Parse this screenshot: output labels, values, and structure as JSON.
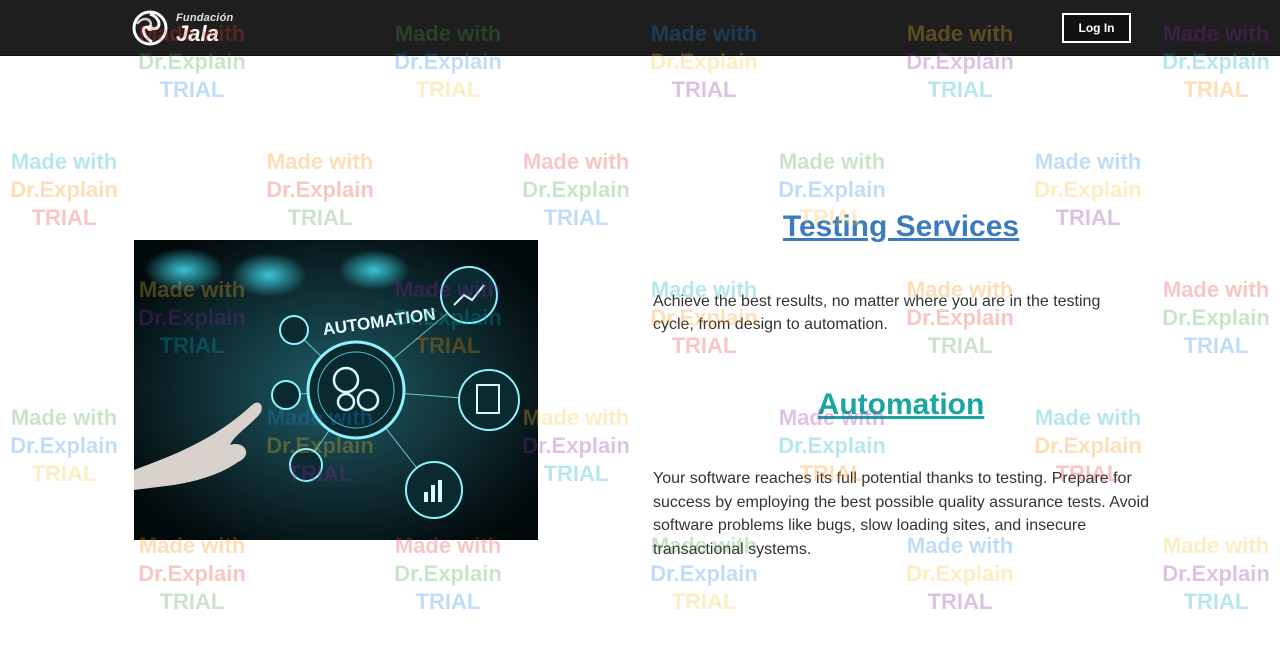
{
  "header": {
    "logo_small": "Fundación",
    "logo_big": "Jala",
    "login_label": "Log In"
  },
  "hero": {
    "image_label": "AUTOMATION"
  },
  "sections": {
    "testing": {
      "title": "Testing Services",
      "text": "Achieve the best results, no matter where you are in the testing cycle, from design to automation."
    },
    "automation": {
      "title": "Automation",
      "text": "Your software reaches its full potential thanks to testing. Prepare for success by employing the best possible quality assurance tests. Avoid software problems like bugs, slow loading sites, and insecure transactional systems."
    }
  },
  "watermark": {
    "line1": "Made with",
    "line2": "Dr.Explain",
    "line3": "TRIAL"
  },
  "colors": {
    "header_bg": "#1e1e1e",
    "title_blue": "#3a7cbf",
    "title_teal": "#1aa6a0"
  }
}
